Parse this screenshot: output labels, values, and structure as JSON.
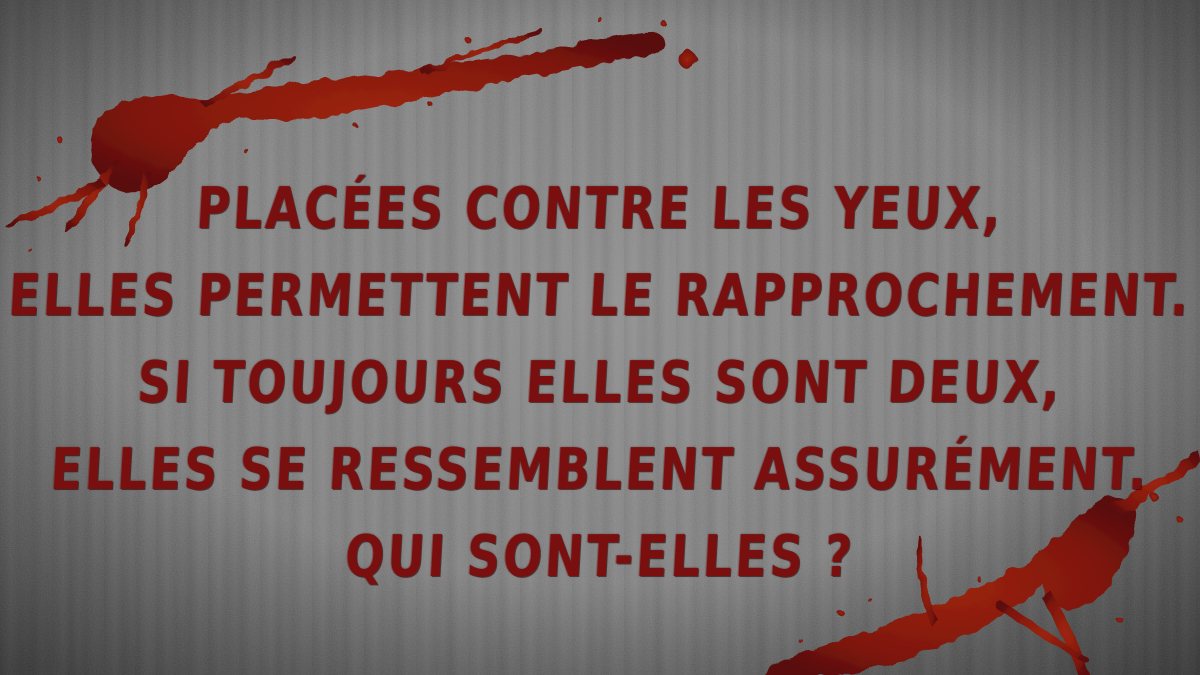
{
  "riddle": {
    "lines": [
      "Placées contre les yeux,",
      "Elles permettent le rapprochement.",
      "Si toujours elles sont deux,",
      "Elles se ressemblent assurément.",
      "Qui sont-elles ?"
    ]
  },
  "background": {
    "surface": "concrete-wall-texture",
    "decoration": "blood-splatter",
    "colors": {
      "wall": "#7d7e7d",
      "blood": "#8a1a0f",
      "text": "#7a0f0f"
    }
  }
}
